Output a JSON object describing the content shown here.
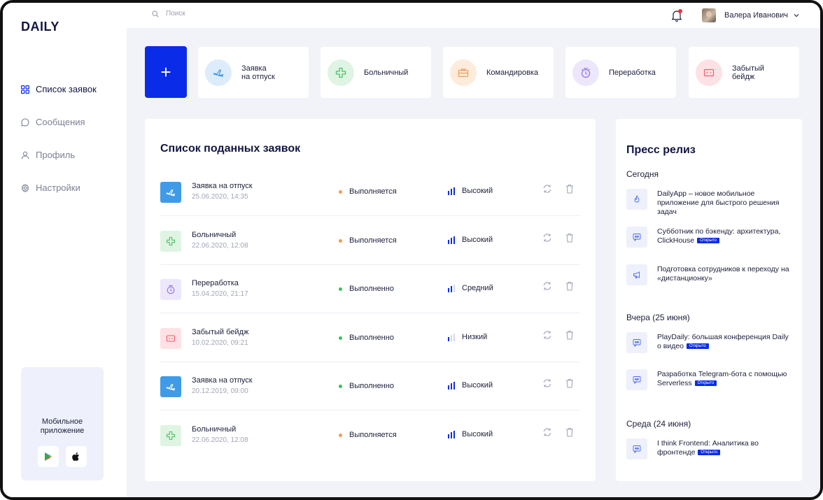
{
  "app": {
    "logo": "DAILY"
  },
  "sidebar": {
    "items": [
      {
        "label": "Список заявок",
        "icon": "grid-icon",
        "active": true
      },
      {
        "label": "Сообщения",
        "icon": "chat-icon",
        "active": false
      },
      {
        "label": "Профиль",
        "icon": "user-icon",
        "active": false
      },
      {
        "label": "Настройки",
        "icon": "settings-icon",
        "active": false
      }
    ],
    "mobile": {
      "title": "Мобильное приложение",
      "stores": [
        "google-play-icon",
        "apple-icon"
      ]
    }
  },
  "topbar": {
    "search_placeholder": "Поиск",
    "user_name": "Валера Иванович",
    "notification_dot": "#ef3340"
  },
  "quick_actions": {
    "add_label": "+",
    "tiles": [
      {
        "label": "Заявка\nна отпуск",
        "icon": "plane-icon",
        "bg": "#dcecfb",
        "color": "#3f9be8"
      },
      {
        "label": "Больничный",
        "icon": "cross-icon",
        "bg": "#dff4e3",
        "color": "#4cc063"
      },
      {
        "label": "Командировка",
        "icon": "briefcase-icon",
        "bg": "#fdebdc",
        "color": "#f39a52"
      },
      {
        "label": "Переработка",
        "icon": "clock-icon",
        "bg": "#ece7fb",
        "color": "#8f72e6"
      },
      {
        "label": "Забытый\nбейдж",
        "icon": "badge-card-icon",
        "bg": "#fde1e5",
        "color": "#ef5b6e"
      }
    ]
  },
  "requests": {
    "title": "Список поданных заявок",
    "rows": [
      {
        "title": "Заявка на отпуск",
        "date": "25.06.2020,  14:35",
        "status": "Выполняется",
        "status_color": "#f39a52",
        "priority": "Высокий",
        "level": 3,
        "type": "plane"
      },
      {
        "title": "Больничный",
        "date": "22.06.2020,  12:08",
        "status": "Выполняется",
        "status_color": "#f39a52",
        "priority": "Высокий",
        "level": 3,
        "type": "cross"
      },
      {
        "title": "Переработка",
        "date": "15.04.2020,  21:17",
        "status": "Выполненно",
        "status_color": "#3cbf5a",
        "priority": "Средний",
        "level": 2,
        "type": "clock"
      },
      {
        "title": "Забытый бейдж",
        "date": "10.02.2020,  09:21",
        "status": "Выполненно",
        "status_color": "#3cbf5a",
        "priority": "Низкий",
        "level": 1,
        "type": "badge"
      },
      {
        "title": "Заявка на отпуск",
        "date": "20.12.2019,  09:00",
        "status": "Выполненно",
        "status_color": "#3cbf5a",
        "priority": "Высокий",
        "level": 3,
        "type": "plane"
      },
      {
        "title": "Больничный",
        "date": "22.06.2020,  12:08",
        "status": "Выполняется",
        "status_color": "#f39a52",
        "priority": "Высокий",
        "level": 3,
        "type": "cross"
      }
    ]
  },
  "press": {
    "title": "Пресс релиз",
    "badge_label": "Открыто",
    "sections": [
      {
        "title": "Сегодня",
        "items": [
          {
            "text": "DailyApp – новое мобильное приложение для быстрого решения задач",
            "icon": "fire-icon",
            "badge": false
          },
          {
            "text": "Субботник по бэкенду: архитектура, ClickHouse",
            "icon": "message-icon",
            "badge": true
          },
          {
            "text": "Подготовка сотрудников к переходу на «дистанционку»",
            "icon": "megaphone-icon",
            "badge": false
          }
        ]
      },
      {
        "title": "Вчера (25 июня)",
        "items": [
          {
            "text": "PlayDaily: большая конференция Daily о видео",
            "icon": "message-icon",
            "badge": true
          },
          {
            "text": "Разработка Telegram-бота с помощью Serverless",
            "icon": "message-icon",
            "badge": true
          }
        ]
      },
      {
        "title": "Среда (24 июня)",
        "items": [
          {
            "text": "I think Frontend: Аналитика во фронтенде",
            "icon": "message-icon",
            "badge": true
          }
        ]
      }
    ]
  },
  "colors": {
    "accent": "#0a2ce8",
    "background": "#f2f3f8"
  }
}
